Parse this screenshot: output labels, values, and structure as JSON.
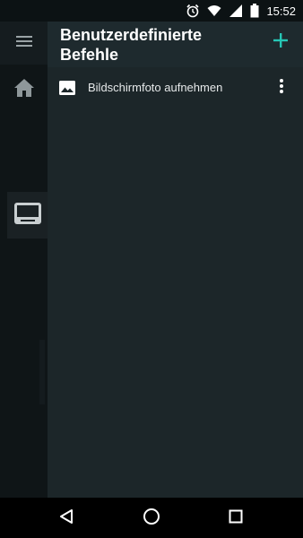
{
  "status_bar": {
    "time": "15:52",
    "icons": [
      "alarm-icon",
      "wifi-icon",
      "signal-icon",
      "battery-icon"
    ]
  },
  "rail": {
    "icons": [
      "menu-icon",
      "home-icon",
      "keyboard-icon"
    ]
  },
  "panel": {
    "title": "Benutzerdefinierte Befehle",
    "add_icon": "plus-icon",
    "accent_color": "#26c6b5",
    "items": [
      {
        "label": "Bildschirmfoto aufnehmen",
        "icon": "image-icon"
      }
    ]
  },
  "nav_bar": {
    "icons": [
      "back-icon",
      "home-circle-icon",
      "recents-icon"
    ]
  }
}
